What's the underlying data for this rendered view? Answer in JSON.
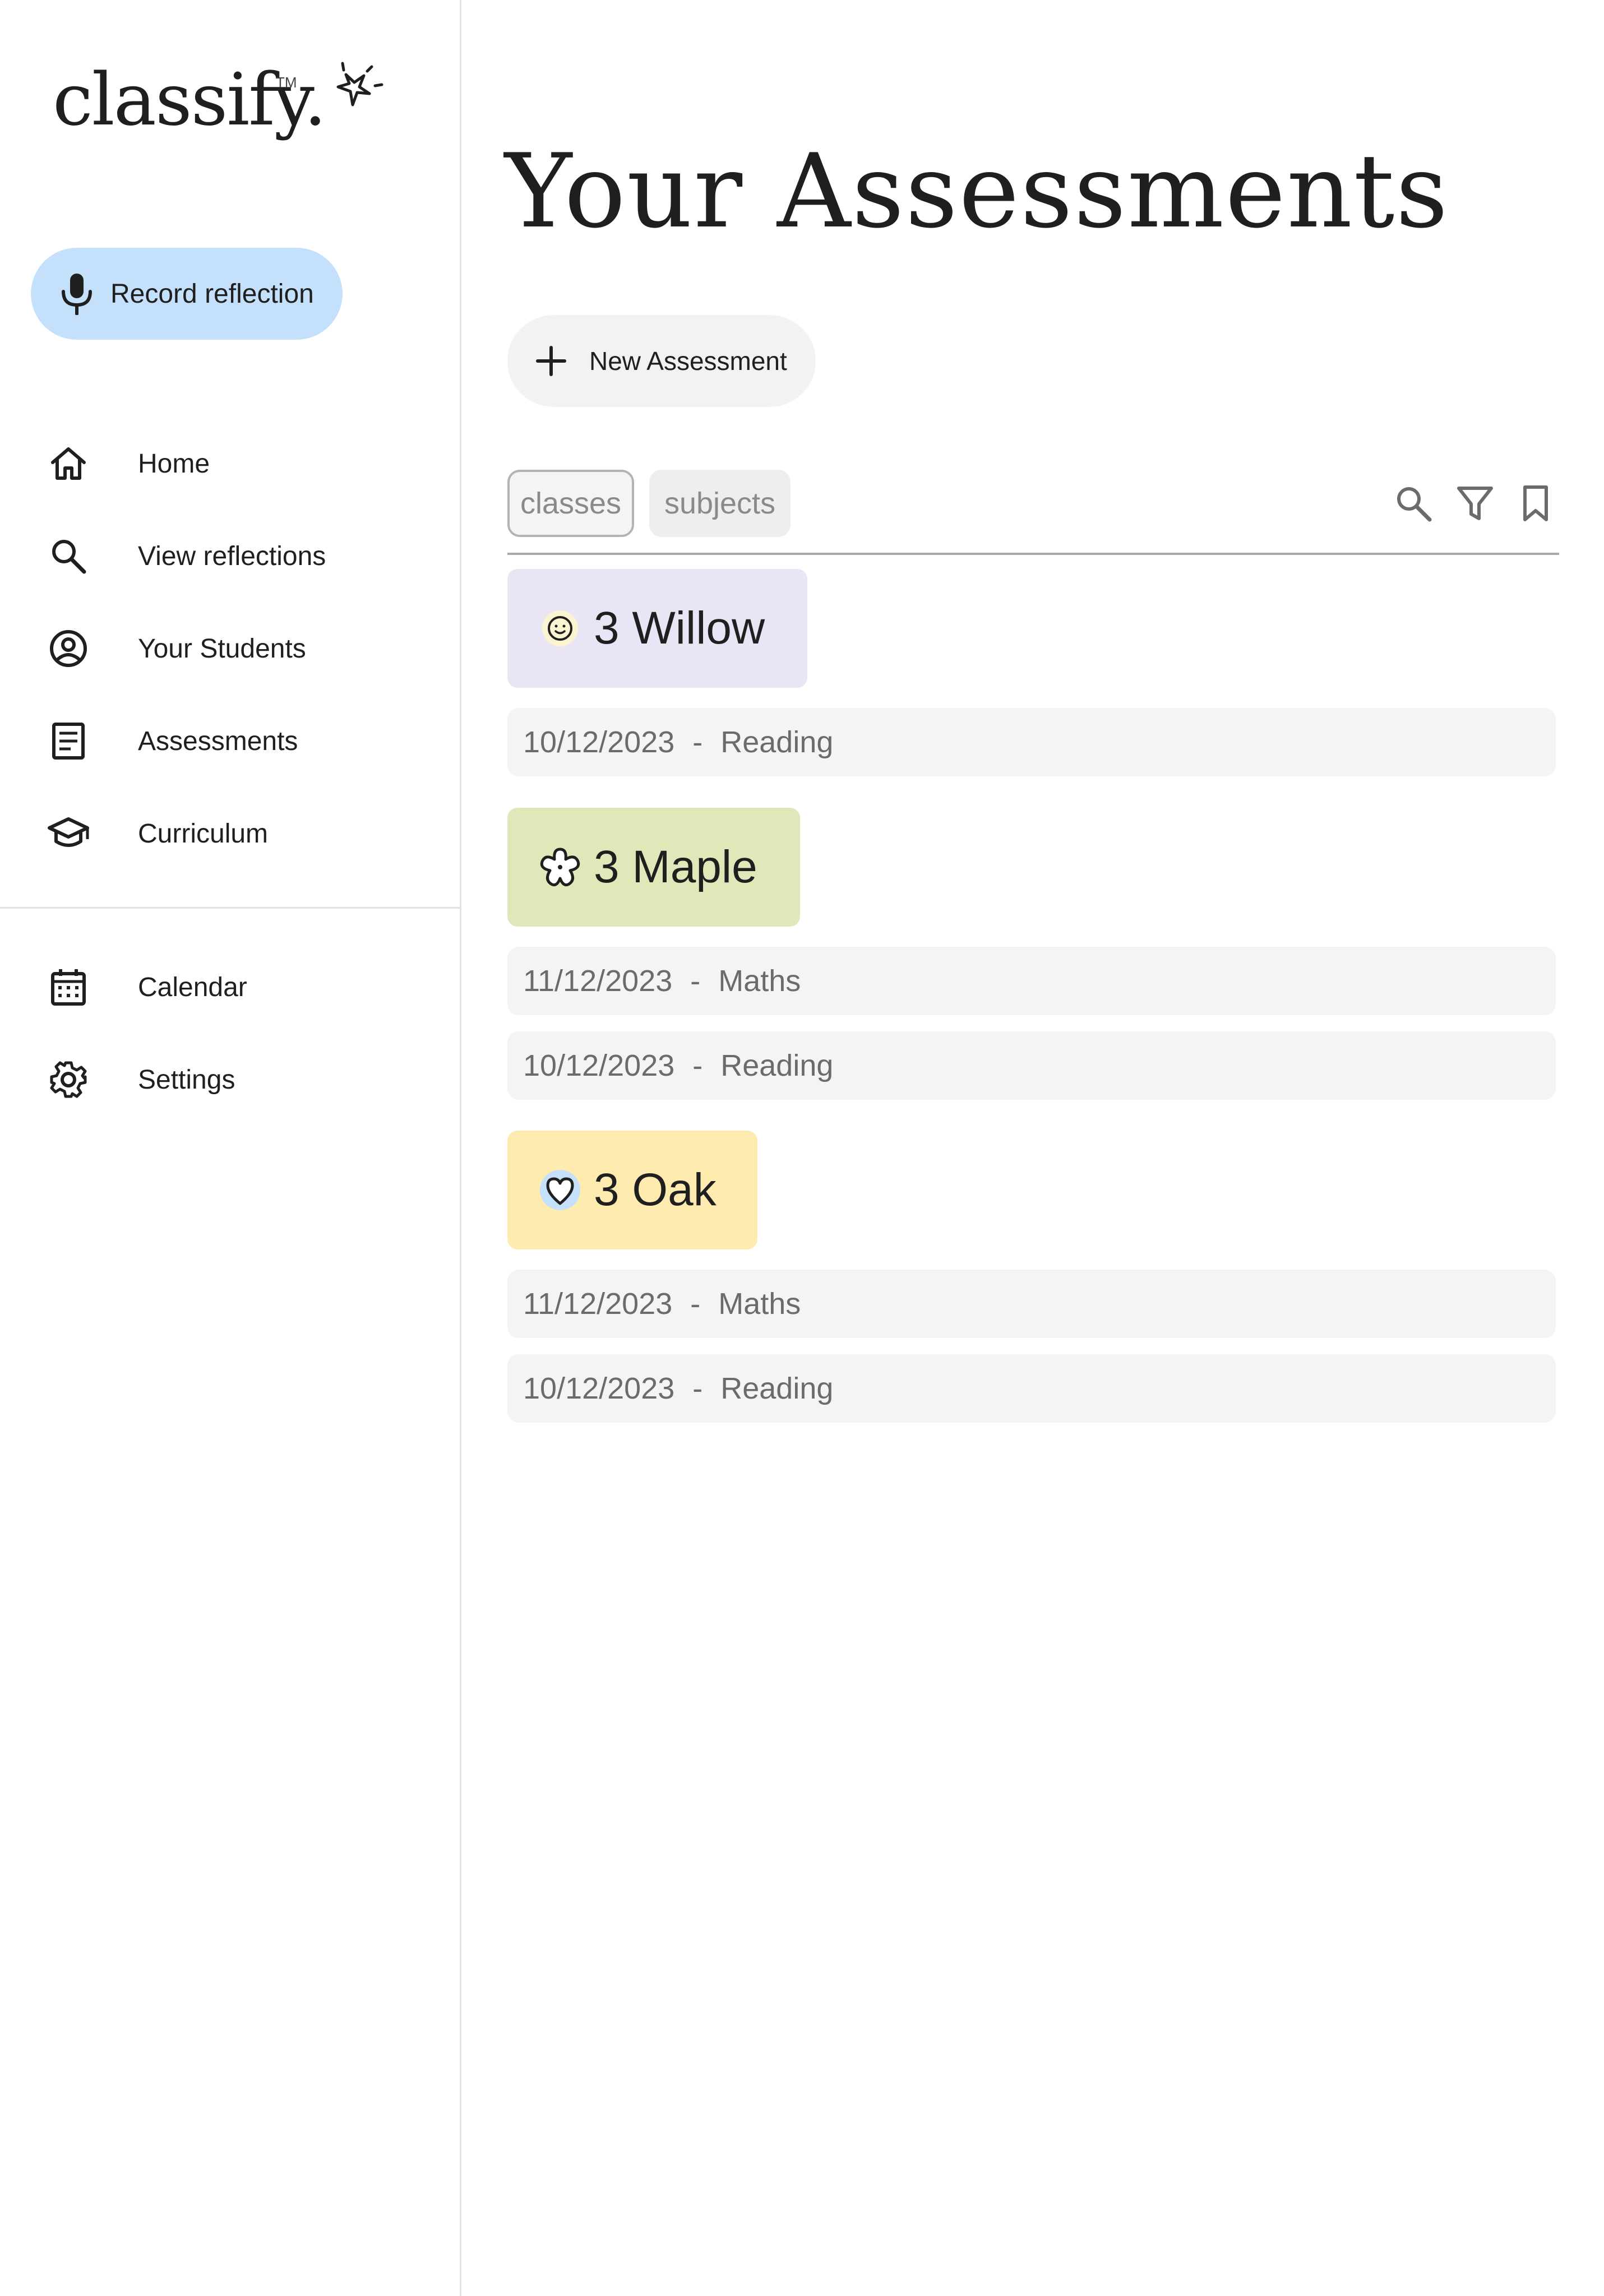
{
  "brand": {
    "logo_text": "classify.",
    "trademark": "TM"
  },
  "sidebar": {
    "record_label": "Record reflection",
    "items": [
      {
        "label": "Home",
        "icon": "home-icon"
      },
      {
        "label": "View reflections",
        "icon": "search-icon"
      },
      {
        "label": "Your Students",
        "icon": "user-circle-icon"
      },
      {
        "label": "Assessments",
        "icon": "document-icon"
      },
      {
        "label": "Curriculum",
        "icon": "graduation-cap-icon"
      }
    ],
    "bottom_items": [
      {
        "label": "Calendar",
        "icon": "calendar-icon"
      },
      {
        "label": "Settings",
        "icon": "gear-icon"
      }
    ]
  },
  "main": {
    "title": "Your Assessments",
    "new_label": "New Assessment",
    "filters": {
      "classes": "classes",
      "subjects": "subjects"
    },
    "tool_icons": [
      "search-icon",
      "filter-icon",
      "bookmark-icon"
    ],
    "groups": [
      {
        "name": "3 Willow",
        "color": "#e9e5f4",
        "icon": "smiley-icon",
        "assessments": [
          {
            "date": "10/12/2023",
            "sep": "-",
            "subject": "Reading"
          }
        ]
      },
      {
        "name": "3 Maple",
        "color": "#dfe8b8",
        "icon": "flower-icon",
        "assessments": [
          {
            "date": "11/12/2023",
            "sep": "-",
            "subject": "Maths"
          },
          {
            "date": "10/12/2023",
            "sep": "-",
            "subject": "Reading"
          }
        ]
      },
      {
        "name": "3 Oak",
        "color": "#fdebb0",
        "icon": "heart-icon",
        "assessments": [
          {
            "date": "11/12/2023",
            "sep": "-",
            "subject": "Maths"
          },
          {
            "date": "10/12/2023",
            "sep": "-",
            "subject": "Reading"
          }
        ]
      }
    ]
  }
}
